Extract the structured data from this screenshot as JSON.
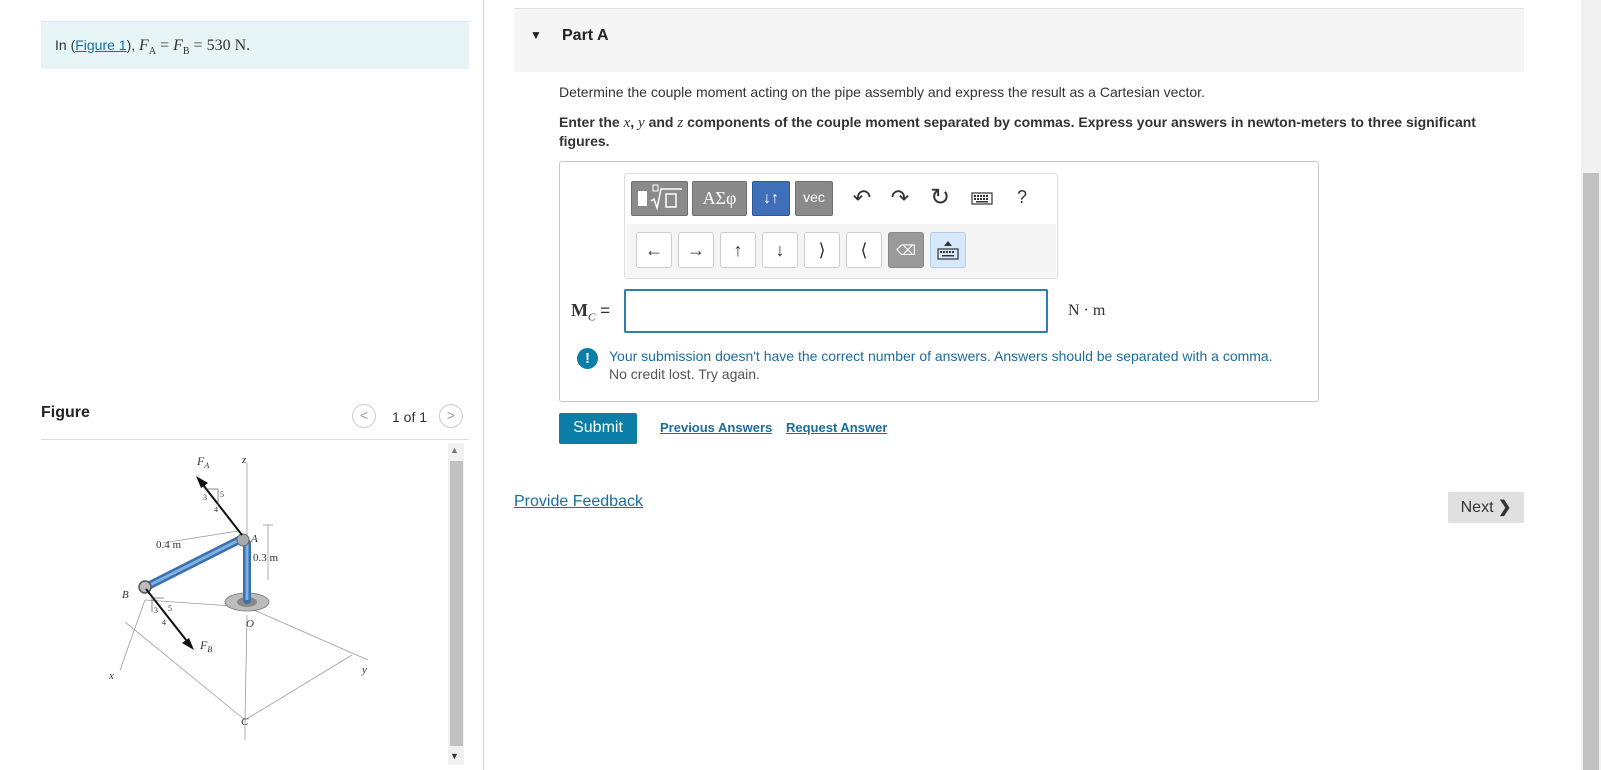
{
  "intro": {
    "prefix": "In (",
    "figure_link": "Figure 1",
    "suffix": "),",
    "equation": "F_A = F_B = 530 N."
  },
  "figure_panel": {
    "title": "Figure",
    "counter": "1 of 1",
    "labels": {
      "fa": "F",
      "fa_sub": "A",
      "z": "z",
      "a": "A",
      "dim_04": "0.4 m",
      "dim_03": "0.3 m",
      "b": "B",
      "o": "O",
      "fb": "F",
      "fb_sub": "B",
      "x": "x",
      "y": "y",
      "c": "C",
      "ratio_3": "3",
      "ratio_4": "4",
      "ratio_5": "5"
    }
  },
  "part": {
    "title": "Part A",
    "question": "Determine the couple moment acting on the pipe assembly and express the result as a Cartesian vector.",
    "instruction_a": "Enter the ",
    "var_x": "x",
    "comma": ", ",
    "var_y": "y",
    "and_text": " and ",
    "var_z": "z",
    "instruction_b": " components of the couple moment separated by commas. Express your answers in newton-meters to three significant figures."
  },
  "toolbar": {
    "symbols_label": "ΑΣφ",
    "sort_label": "↓↑",
    "vec_label": "vec",
    "help_label": "?",
    "nav": [
      "←",
      "→",
      "↑",
      "↓",
      "⟩",
      "⟨"
    ]
  },
  "answer": {
    "label_main": "M",
    "label_sub": "C",
    "equals": " =",
    "value": "",
    "units": "N · m"
  },
  "feedback": {
    "message": "Your submission doesn't have the correct number of answers. Answers should be separated with a comma.",
    "sub": "No credit lost. Try again."
  },
  "actions": {
    "submit": "Submit",
    "previous_answers": "Previous Answers",
    "request_answer": "Request Answer",
    "provide_feedback": "Provide Feedback",
    "next": "Next"
  }
}
